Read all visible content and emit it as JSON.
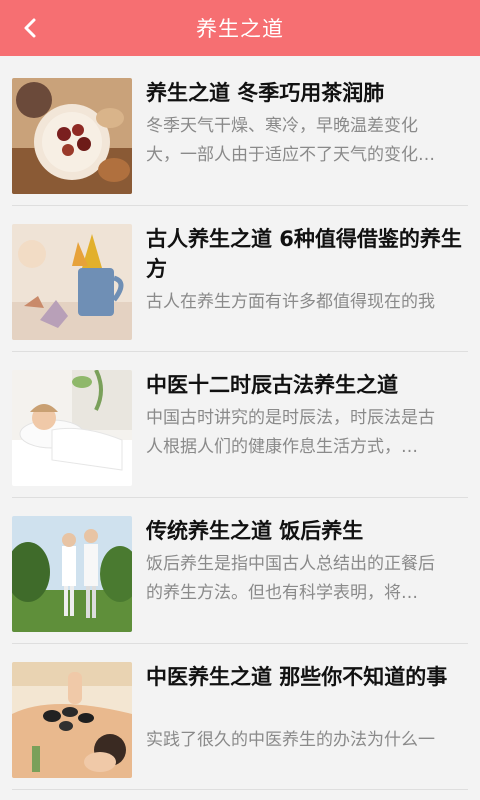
{
  "header": {
    "title": "养生之道",
    "back_icon": "chevron-left-icon",
    "bg_color": "#f66f72"
  },
  "articles": [
    {
      "title": "养生之道 冬季巧用茶润肺",
      "desc": "冬季天气干燥、寒冷，早晚温差变化\n大，一部人由于适应不了天气的变化…"
    },
    {
      "title": "古人养生之道 6种值得借鉴的养生方",
      "desc": "古人在养生方面有许多都值得现在的我"
    },
    {
      "title": "中医十二时辰古法养生之道",
      "desc": "中国古时讲究的是时辰法，时辰法是古\n人根据人们的健康作息生活方式，…"
    },
    {
      "title": "传统养生之道 饭后养生",
      "desc": "饭后养生是指中国古人总结出的正餐后\n的养生方法。但也有科学表明，将…"
    },
    {
      "title": "中医养生之道 那些你不知道的事",
      "desc": "实践了很久的中医养生的办法为什么一"
    }
  ]
}
